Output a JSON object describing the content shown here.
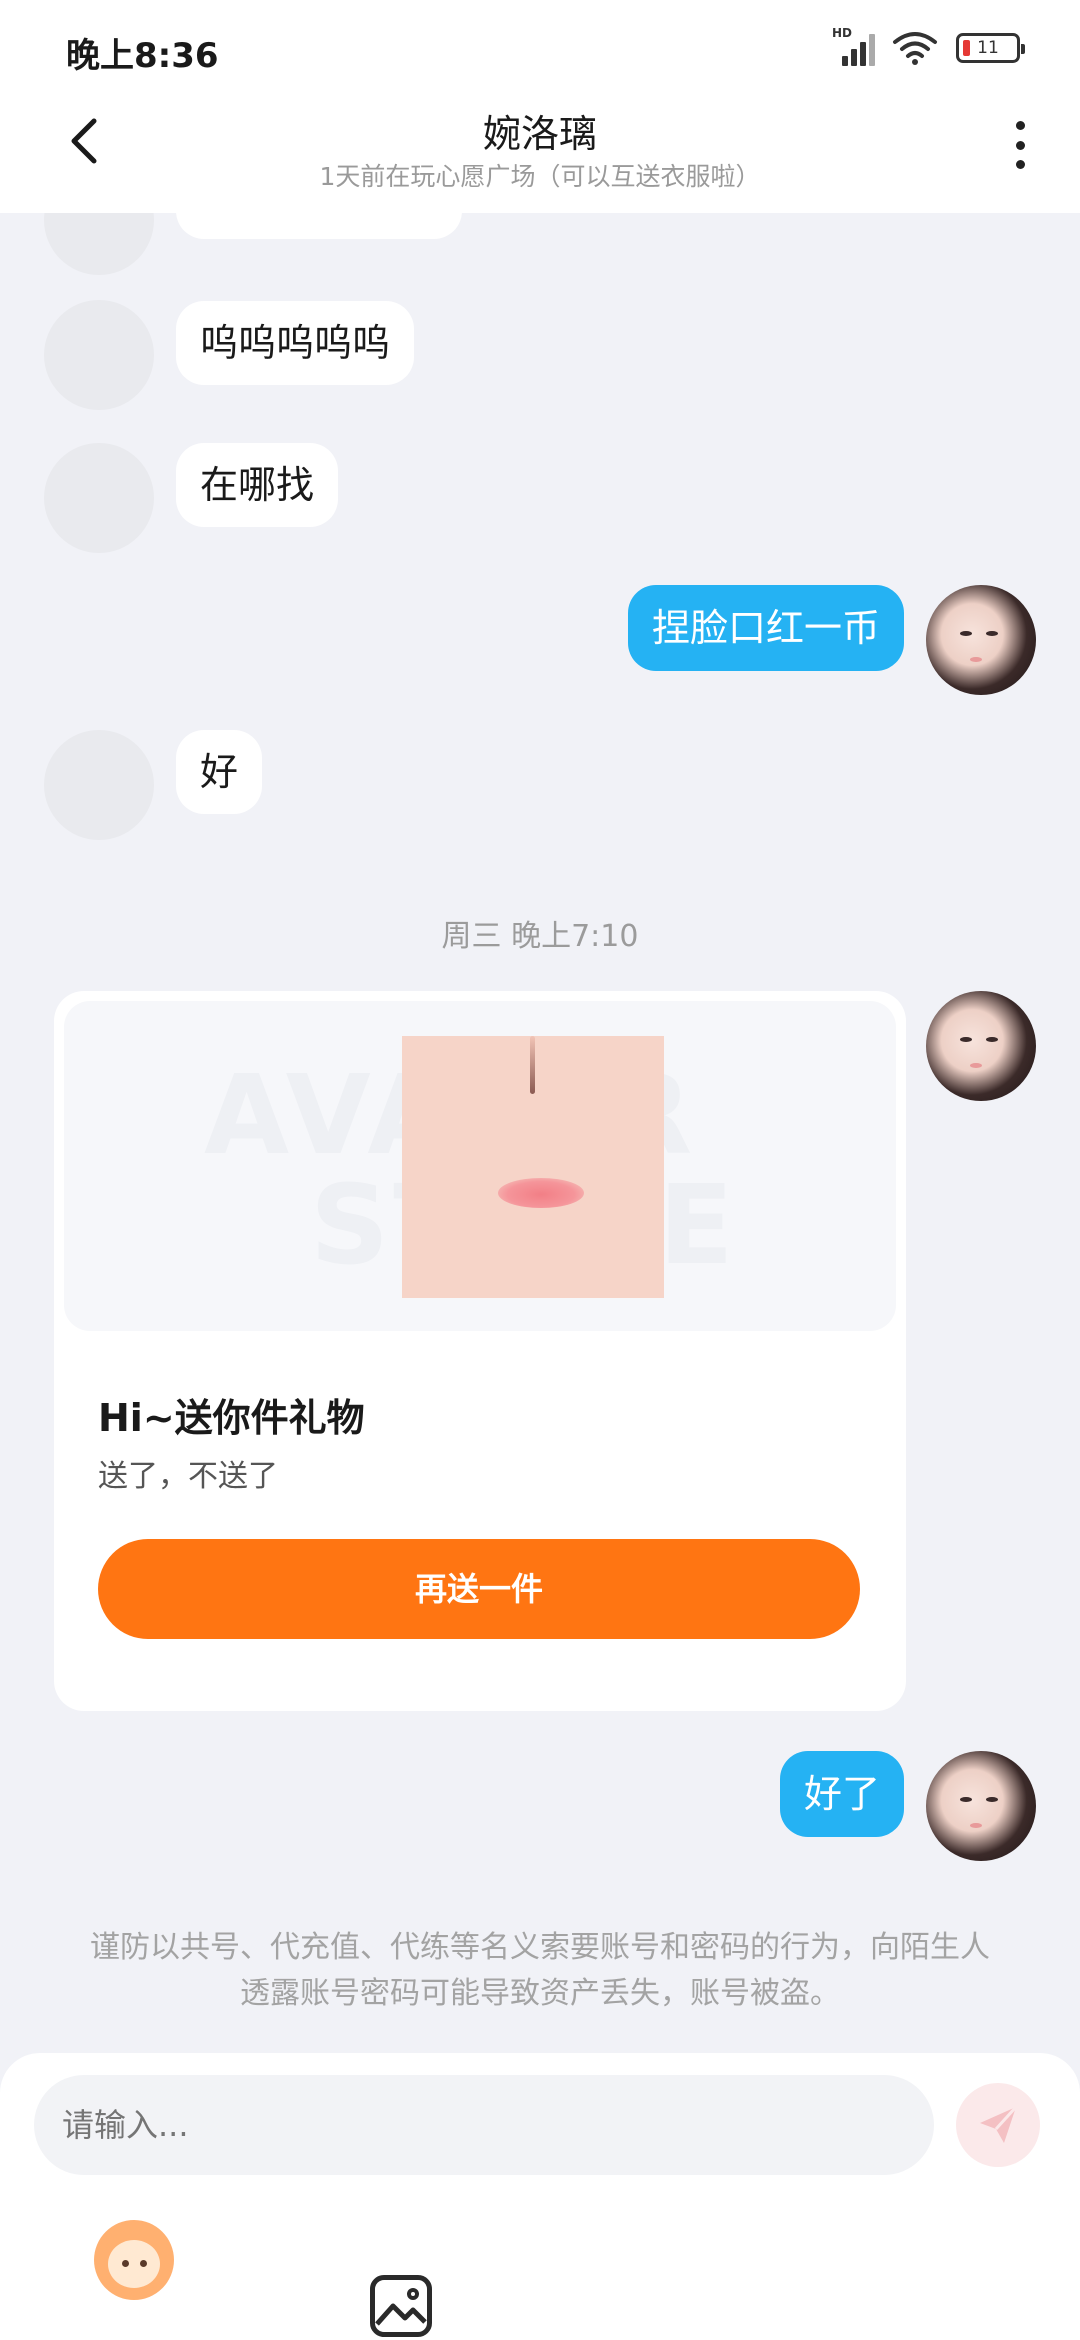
{
  "status_bar": {
    "time": "晚上8:36",
    "network": "HD",
    "battery": "11"
  },
  "header": {
    "title": "婉洛璃",
    "subtitle": "1天前在玩心愿广场（可以互送衣服啦）"
  },
  "messages": [
    {
      "side": "left",
      "text": "呜呜呜呜呜"
    },
    {
      "side": "left",
      "text": "在哪找"
    },
    {
      "side": "right",
      "text": "捏脸口红一币"
    },
    {
      "side": "left",
      "text": "好"
    },
    {
      "side": "right",
      "text": "好了"
    }
  ],
  "timestamp": "周三 晚上7:10",
  "gift_card": {
    "watermark": [
      "AVATAR",
      "STORE"
    ],
    "title": "Hi~送你件礼物",
    "description": "送了，不送了",
    "button_label": "再送一件",
    "button_color": "#ff7512"
  },
  "warning": "谨防以共号、代充值、代练等名义索要账号和密码的行为，向陌生人透露账号密码可能导致资产丢失，账号被盗。",
  "input": {
    "placeholder": "请输入..."
  },
  "colors": {
    "accent_blue": "#25b2f3",
    "background": "#f1f2f7"
  }
}
